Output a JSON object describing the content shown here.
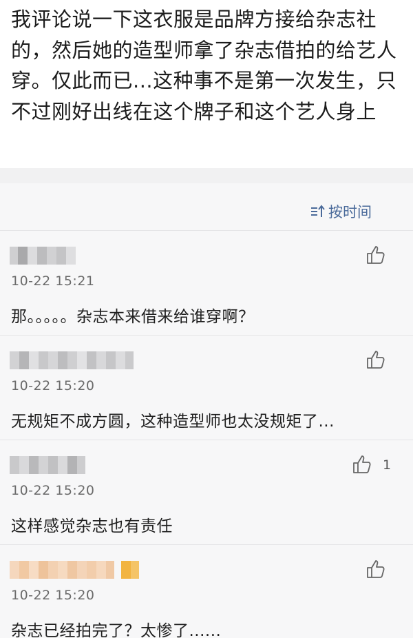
{
  "post": {
    "text": "我评论说一下这衣服是品牌方接给杂志社的，然后她的造型师拿了杂志借拍的给艺人穿。仅此而已...这种事不是第一次发生，只不过刚好出线在这个牌子和这个艺人身上"
  },
  "sort": {
    "label": "按时间",
    "icon": "sort-icon"
  },
  "comments": [
    {
      "time": "10-22 15:21",
      "text": "那。。。。。杂志本来借来给谁穿啊？",
      "likes": ""
    },
    {
      "time": "10-22 15:20",
      "text": "无规矩不成方圆，这种造型师也太没规矩了...",
      "likes": ""
    },
    {
      "time": "10-22 15:20",
      "text": "这样感觉杂志也有责任",
      "likes": "1"
    },
    {
      "time": "10-22 15:20",
      "text": "杂志已经拍完了？太惨了......",
      "likes": ""
    }
  ],
  "colors": {
    "accent": "#4a6a9a",
    "divider": "#e4e4e6",
    "background": "#f7f7f8"
  }
}
